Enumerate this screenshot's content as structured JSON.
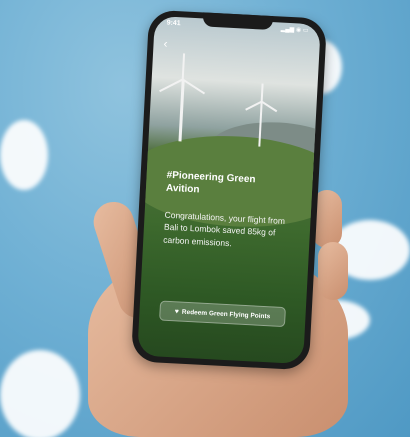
{
  "status_bar": {
    "time": "9:41",
    "icons": "▂▄▆ ◉ ▭"
  },
  "nav": {
    "back_icon": "‹"
  },
  "hero": {
    "title": "#Pioneering Green Avition",
    "message": "Congratulations, your flight from Bali to Lombok saved 85kg of carbon emissions."
  },
  "cta": {
    "label": "Redeem Green Flying Points",
    "icon": "leaf-icon"
  }
}
